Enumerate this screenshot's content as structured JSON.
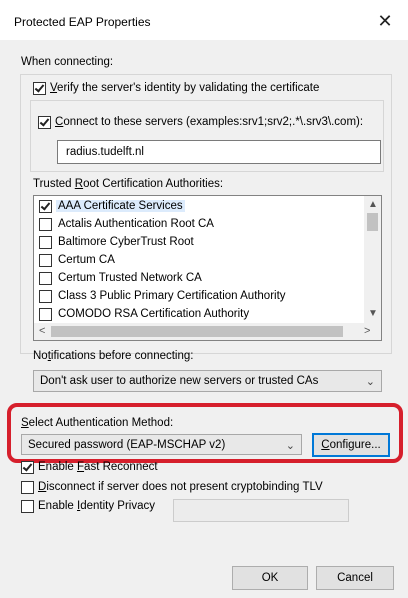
{
  "window": {
    "title": "Protected EAP Properties",
    "close_glyph": "✕"
  },
  "connecting": {
    "section_label": "When connecting:",
    "verify_server": {
      "checked": true,
      "prefix": "",
      "accel": "V",
      "rest": "erify the server's identity by validating the certificate"
    },
    "connect_servers": {
      "checked": true,
      "accel": "C",
      "rest": "onnect to these servers (examples:srv1;srv2;.*\\.srv3\\.com):"
    },
    "servers_value": "radius.tudelft.nl",
    "trusted_ca_label_pre": "Trusted ",
    "trusted_ca_accel": "R",
    "trusted_ca_label_post": "oot Certification Authorities:",
    "ca_list": [
      {
        "label": "AAA Certificate Services",
        "checked": true,
        "selected": true
      },
      {
        "label": "Actalis Authentication Root CA",
        "checked": false,
        "selected": false
      },
      {
        "label": "Baltimore CyberTrust Root",
        "checked": false,
        "selected": false
      },
      {
        "label": "Certum CA",
        "checked": false,
        "selected": false
      },
      {
        "label": "Certum Trusted Network CA",
        "checked": false,
        "selected": false
      },
      {
        "label": "Class 3 Public Primary Certification Authority",
        "checked": false,
        "selected": false
      },
      {
        "label": "COMODO RSA Certification Authority",
        "checked": false,
        "selected": false
      }
    ]
  },
  "notifications": {
    "label_pre": "No",
    "label_accel": "t",
    "label_post": "ifications before connecting:",
    "selected": "Don't ask user to authorize new servers or trusted CAs"
  },
  "auth_method": {
    "label_accel": "S",
    "label_rest": "elect Authentication Method:",
    "selected": "Secured password (EAP-MSCHAP v2)",
    "configure_accel": "C",
    "configure_rest": "onfigure..."
  },
  "options": {
    "fast_reconnect": {
      "checked": true,
      "pre": "Enable ",
      "accel": "F",
      "post": "ast Reconnect"
    },
    "disconnect": {
      "checked": false,
      "accel": "D",
      "post": "isconnect if server does not present cryptobinding TLV"
    },
    "identity_privacy": {
      "checked": false,
      "pre": "Enable ",
      "accel": "I",
      "post": "dentity Privacy"
    }
  },
  "buttons": {
    "ok": "OK",
    "cancel": "Cancel"
  },
  "glyphs": {
    "chevron_down": "⌄",
    "arrow_up": "▲",
    "arrow_down": "▼",
    "arrow_left": "<",
    "arrow_right": ">"
  },
  "colors": {
    "highlight": "#d61f2c",
    "selection": "#dcebfc",
    "focus": "#0078d7"
  }
}
